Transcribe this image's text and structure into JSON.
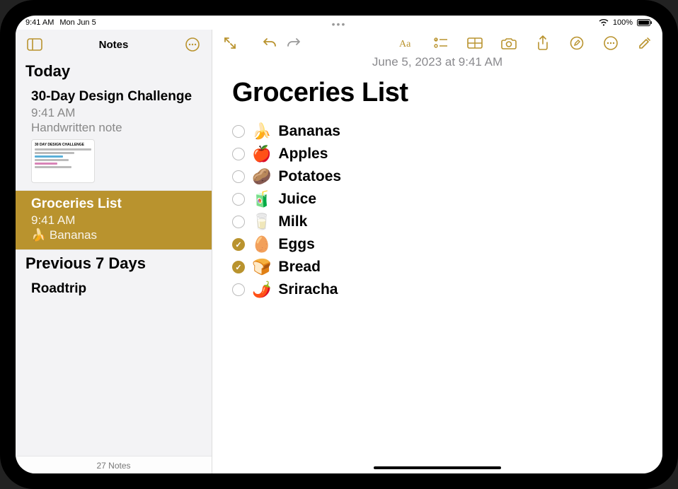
{
  "status": {
    "time": "9:41 AM",
    "date": "Mon Jun 5",
    "battery": "100%"
  },
  "sidebar": {
    "title": "Notes",
    "sections": [
      {
        "header": "Today"
      },
      {
        "header": "Previous 7 Days"
      }
    ],
    "notes": [
      {
        "title": "30-Day Design Challenge",
        "time": "9:41 AM",
        "preview": "Handwritten note"
      },
      {
        "title": "Groceries List",
        "time": "9:41 AM",
        "preview": "🍌 Bananas"
      },
      {
        "title": "Roadtrip"
      }
    ],
    "footer": "27 Notes"
  },
  "note": {
    "date": "June 5, 2023 at 9:41 AM",
    "title": "Groceries List",
    "items": [
      {
        "emoji": "🍌",
        "label": "Bananas",
        "checked": false
      },
      {
        "emoji": "🍎",
        "label": "Apples",
        "checked": false
      },
      {
        "emoji": "🥔",
        "label": "Potatoes",
        "checked": false
      },
      {
        "emoji": "🧃",
        "label": "Juice",
        "checked": false
      },
      {
        "emoji": "🥛",
        "label": "Milk",
        "checked": false
      },
      {
        "emoji": "🥚",
        "label": "Eggs",
        "checked": true
      },
      {
        "emoji": "🍞",
        "label": "Bread",
        "checked": true
      },
      {
        "emoji": "🌶️",
        "label": "Sriracha",
        "checked": false
      }
    ]
  }
}
